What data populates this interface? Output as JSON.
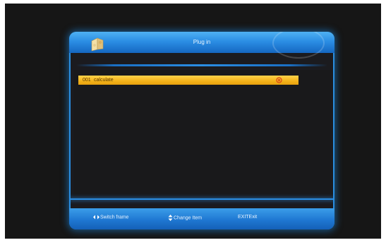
{
  "window": {
    "title": "Plug in"
  },
  "list": {
    "items": [
      {
        "number": "001",
        "name": "calculate",
        "mark_icon": "x-circle-icon"
      }
    ],
    "selected_color": "#f3b21a"
  },
  "footer": {
    "hints": [
      {
        "icon": "left-right-arrows-icon",
        "label": "Switch frame"
      },
      {
        "icon": "up-down-arrows-icon",
        "label": "Change Item"
      },
      {
        "icon": "",
        "label": "EXITExit"
      }
    ]
  },
  "colors": {
    "frame_blue": "#2b8ee4",
    "background": "#161616"
  }
}
